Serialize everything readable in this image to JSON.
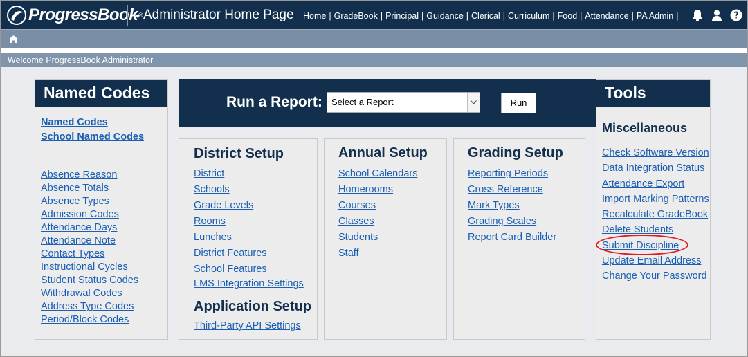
{
  "app": {
    "logo_text": "ProgressBook",
    "page_title": "Administrator Home Page"
  },
  "topnav": [
    "Home",
    "GradeBook",
    "Principal",
    "Guidance",
    "Clerical",
    "Curriculum",
    "Food",
    "Attendance",
    "PA Admin"
  ],
  "top_icons": [
    "bell-icon",
    "user-icon",
    "help-icon"
  ],
  "welcome": "Welcome ProgressBook Administrator",
  "named_codes": {
    "title": "Named Codes",
    "top_links": [
      "Named Codes",
      "School Named Codes"
    ],
    "links": [
      "Absence Reason",
      "Absence Totals",
      "Absence Types",
      "Admission Codes",
      "Attendance Days",
      "Attendance Note",
      "Contact Types",
      "Instructional Cycles",
      "Student Status Codes",
      "Withdrawal Codes",
      "Address Type Codes",
      "Period/Block Codes"
    ]
  },
  "report": {
    "label": "Run a Report:",
    "select_value": "Select a Report",
    "run_label": "Run"
  },
  "district_setup": {
    "title": "District Setup",
    "links": [
      "District",
      "Schools",
      "Grade Levels",
      "Rooms",
      "Lunches",
      "District Features",
      "School Features",
      "LMS Integration Settings"
    ]
  },
  "application_setup": {
    "title": "Application Setup",
    "links": [
      "Third-Party API Settings"
    ]
  },
  "annual_setup": {
    "title": "Annual Setup",
    "links": [
      "School Calendars",
      "Homerooms",
      "Courses",
      "Classes",
      "Students",
      "Staff"
    ]
  },
  "grading_setup": {
    "title": "Grading Setup",
    "links": [
      "Reporting Periods",
      "Cross Reference",
      "Mark Types",
      "Grading Scales",
      "Report Card Builder"
    ]
  },
  "tools": {
    "title": "Tools",
    "subtitle": "Miscellaneous",
    "links": [
      "Check Software Version",
      "Data Integration Status",
      "Attendance Export",
      "Import Marking Patterns",
      "Recalculate GradeBook",
      "Delete Students",
      "Submit Discipline",
      "Update Email Address",
      "Change Your Password"
    ]
  },
  "colors": {
    "navy": "#12304d",
    "link": "#1a5fb4",
    "highlight": "#e01b24"
  }
}
